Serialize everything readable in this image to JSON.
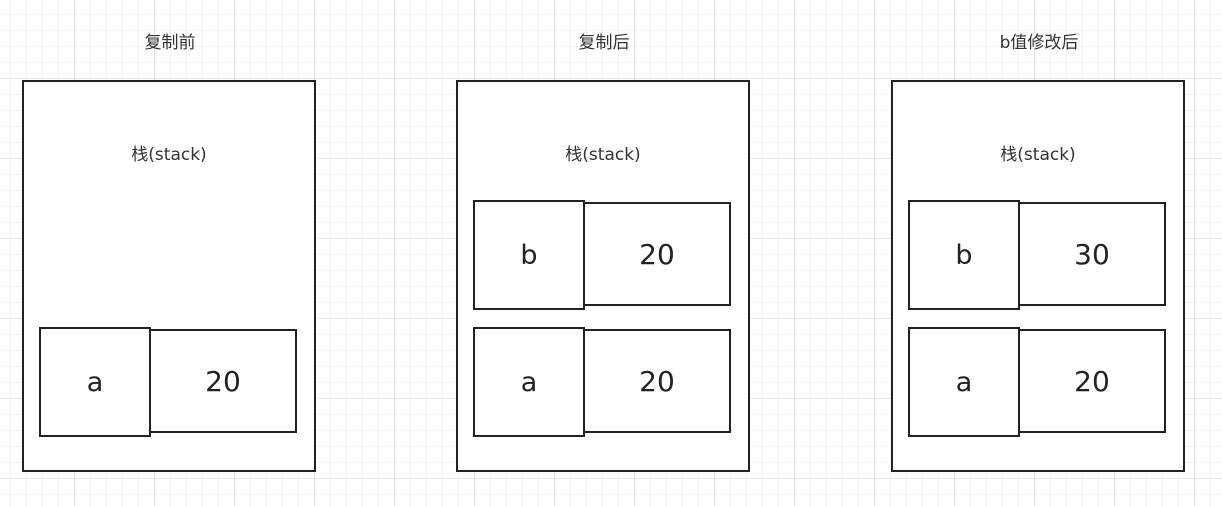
{
  "panels": [
    {
      "title": "复制前",
      "stack_label": "栈(stack)",
      "variables": [
        {
          "name": "a",
          "value": "20"
        }
      ]
    },
    {
      "title": "复制后",
      "stack_label": "栈(stack)",
      "variables": [
        {
          "name": "b",
          "value": "20"
        },
        {
          "name": "a",
          "value": "20"
        }
      ]
    },
    {
      "title": "b值修改后",
      "stack_label": "栈(stack)",
      "variables": [
        {
          "name": "b",
          "value": "30"
        },
        {
          "name": "a",
          "value": "20"
        }
      ]
    }
  ]
}
